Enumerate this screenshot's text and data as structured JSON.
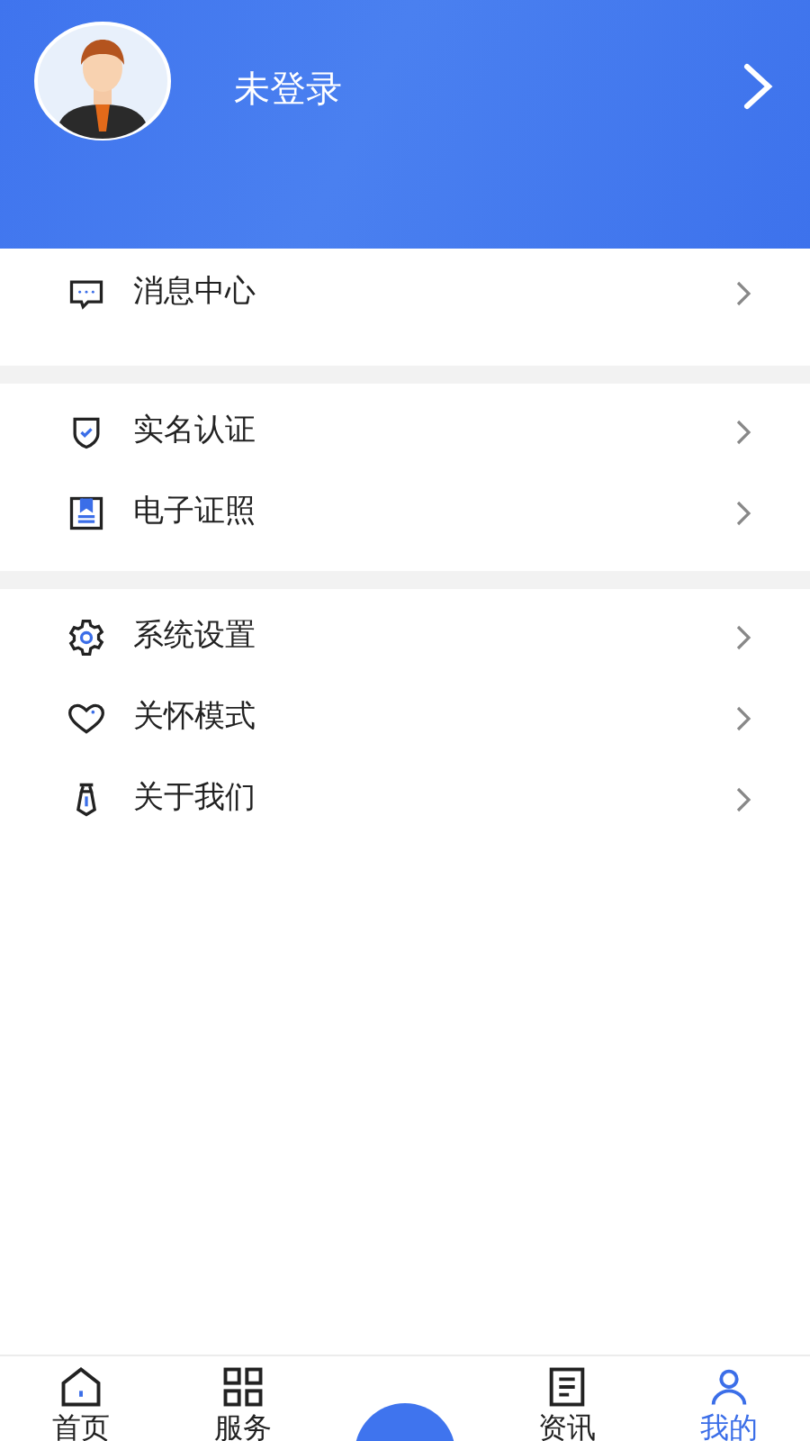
{
  "header": {
    "username": "未登录"
  },
  "menu_groups": [
    {
      "items": [
        {
          "kind": "message",
          "label": "消息中心"
        }
      ]
    },
    {
      "items": [
        {
          "kind": "shield",
          "label": "实名认证"
        },
        {
          "kind": "license",
          "label": "电子证照"
        }
      ]
    },
    {
      "items": [
        {
          "kind": "gear",
          "label": "系统设置"
        },
        {
          "kind": "heart",
          "label": "关怀模式"
        },
        {
          "kind": "tie",
          "label": "关于我们"
        }
      ]
    }
  ],
  "tab_bar": [
    {
      "kind": "home",
      "label": "首页",
      "selected": false
    },
    {
      "kind": "grid",
      "label": "服务",
      "selected": false
    },
    {
      "kind": "center",
      "selected": false
    },
    {
      "kind": "news",
      "label": "资讯",
      "selected": false
    },
    {
      "kind": "user",
      "label": "我的",
      "selected": true
    }
  ]
}
